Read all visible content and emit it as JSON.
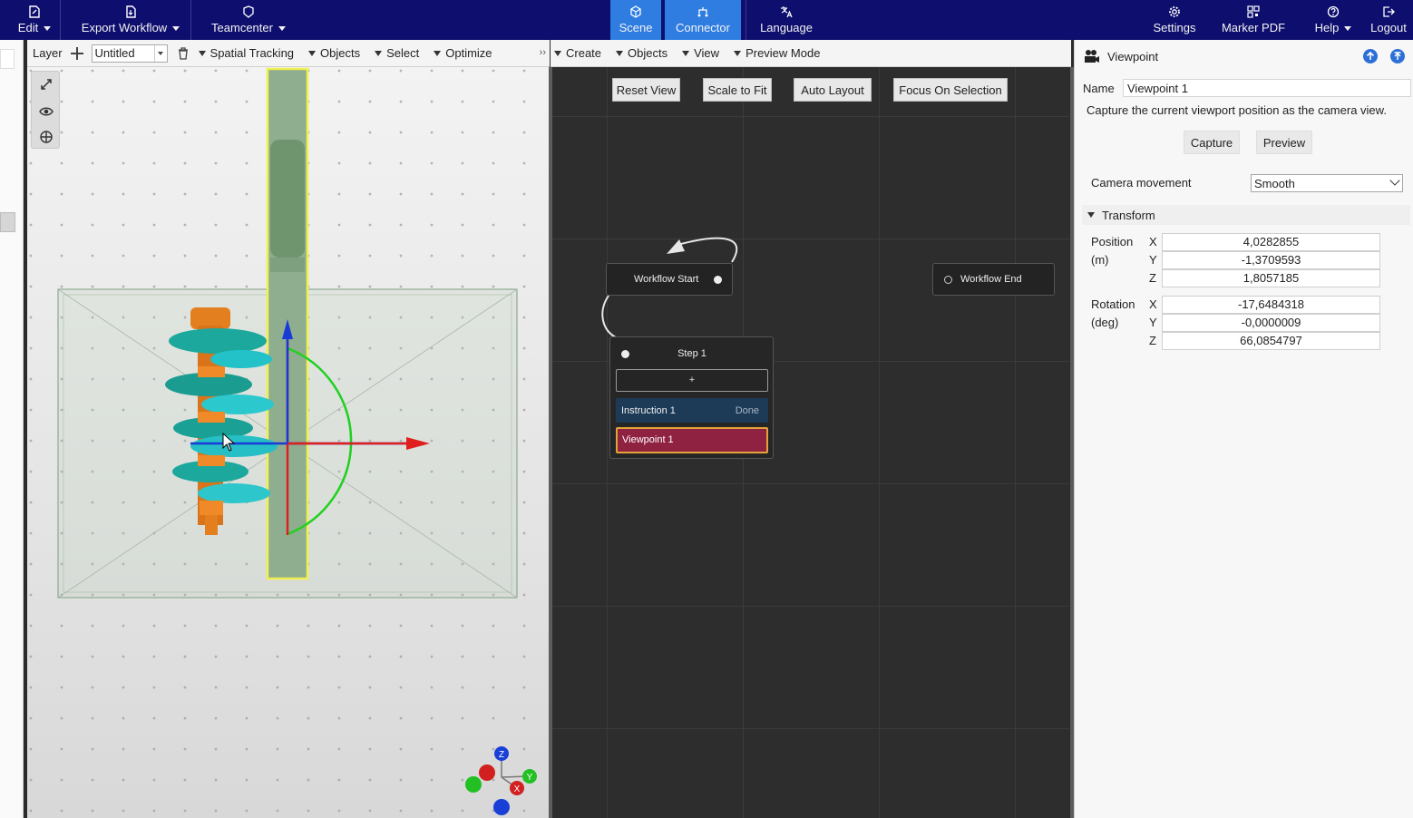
{
  "topbar": {
    "edit": "Edit",
    "export_workflow": "Export Workflow",
    "teamcenter": "Teamcenter",
    "scene": "Scene",
    "connector": "Connector",
    "language": "Language",
    "settings": "Settings",
    "marker_pdf": "Marker PDF",
    "help": "Help",
    "logout": "Logout"
  },
  "scene_toolbar": {
    "layer_label": "Layer",
    "layer_value": "Untitled",
    "spatial_tracking": "Spatial Tracking",
    "objects": "Objects",
    "select": "Select",
    "optimize": "Optimize",
    "more": "››"
  },
  "graph_toolbar": {
    "create": "Create",
    "objects": "Objects",
    "view": "View",
    "preview_mode": "Preview Mode"
  },
  "graph": {
    "buttons": {
      "reset_view": "Reset View",
      "scale_to_fit": "Scale to Fit",
      "auto_layout": "Auto Layout",
      "focus_on_selection": "Focus On Selection"
    },
    "workflow_start": "Workflow Start",
    "workflow_end": "Workflow End",
    "step": {
      "title": "Step 1",
      "add": "+",
      "instruction": "Instruction 1",
      "instruction_status": "Done",
      "viewpoint": "Viewpoint 1"
    }
  },
  "inspector": {
    "title": "Viewpoint",
    "name_label": "Name",
    "name_value": "Viewpoint 1",
    "description": "Capture the current viewport position as the camera view.",
    "capture": "Capture",
    "preview": "Preview",
    "camera_movement_label": "Camera movement",
    "camera_movement_value": "Smooth",
    "transform": "Transform",
    "position_label": "Position",
    "position_unit": "(m)",
    "rotation_label": "Rotation",
    "rotation_unit": "(deg)",
    "axis_x": "X",
    "axis_y": "Y",
    "axis_z": "Z",
    "position": {
      "x": "4,0282855",
      "y": "-1,3709593",
      "z": "1,8057185"
    },
    "rotation": {
      "x": "-17,6484318",
      "y": "-0,0000009",
      "z": "66,0854797"
    }
  },
  "gizmo": {
    "z": "Z",
    "y": "Y",
    "x": "X"
  },
  "colors": {
    "topbar": "#0e0e6e",
    "active_tab": "#2f7de1",
    "instruction": "#1d3a57",
    "viewpoint_node": "#8f2141"
  }
}
